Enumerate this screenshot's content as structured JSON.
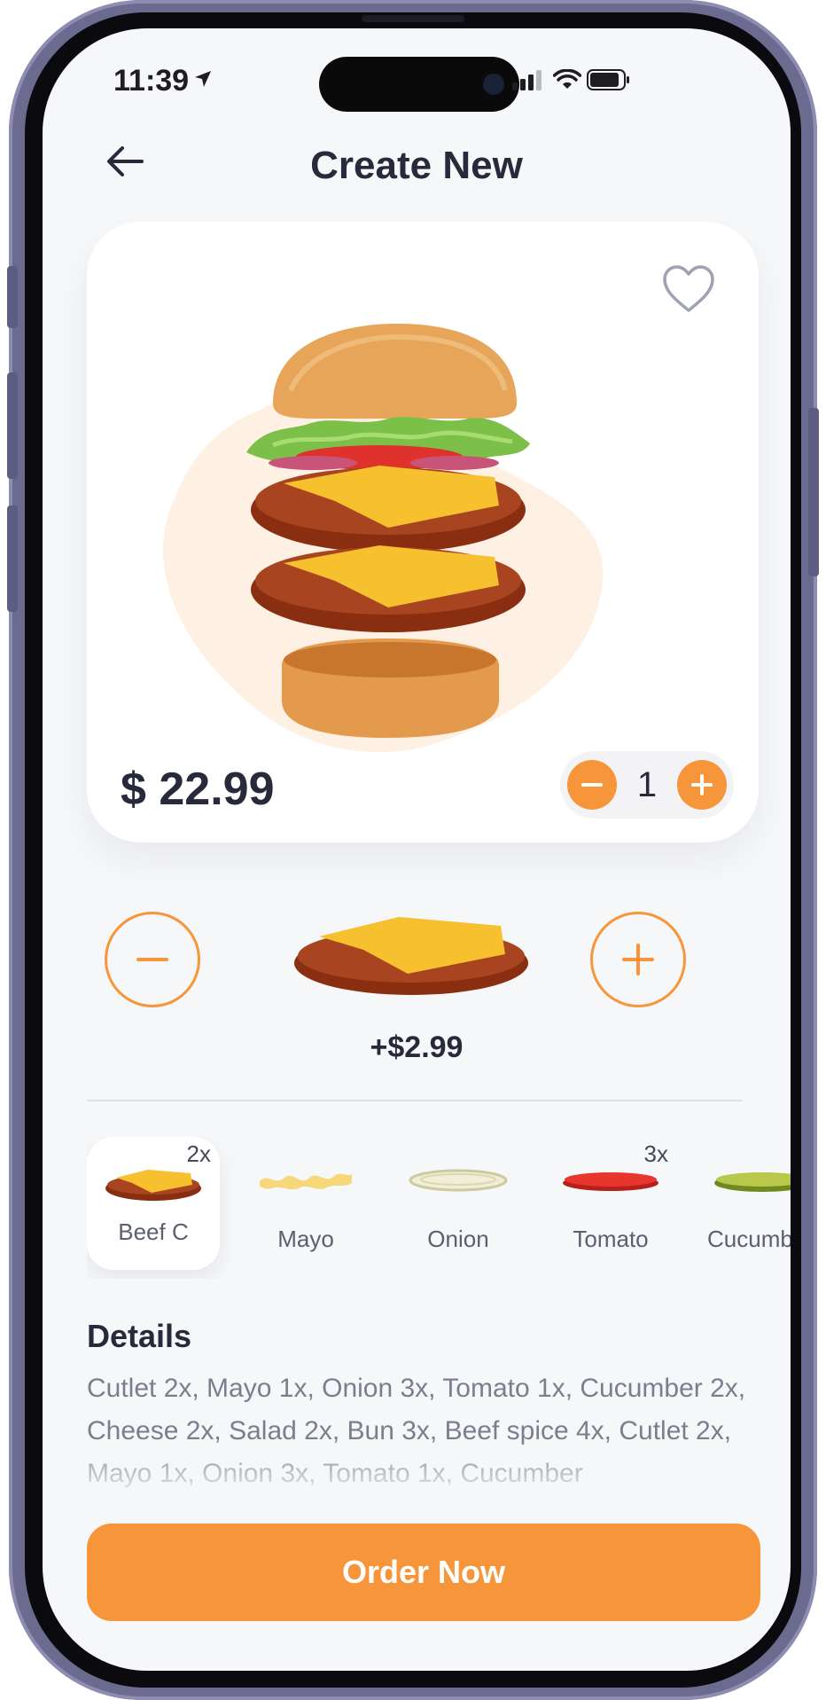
{
  "status_bar": {
    "time": "11:39"
  },
  "header": {
    "title": "Create New"
  },
  "product": {
    "price": "$ 22.99",
    "quantity": "1",
    "favorited": false
  },
  "ingredient_selector": {
    "add_price": "+$2.99"
  },
  "ingredients": [
    {
      "label": "Beef C",
      "badge": "2x",
      "selected": true
    },
    {
      "label": "Mayo",
      "badge": "",
      "selected": false
    },
    {
      "label": "Onion",
      "badge": "",
      "selected": false
    },
    {
      "label": "Tomato",
      "badge": "3x",
      "selected": false
    },
    {
      "label": "Cucumb",
      "badge": "",
      "selected": false
    }
  ],
  "details": {
    "title": "Details",
    "text": "Cutlet 2x, Mayo 1x, Onion 3x, Tomato 1x, Cucumber 2x, Cheese 2x, Salad 2x,  Bun 3x, Beef spice 4x, Cutlet 2x, Mayo 1x, Onion 3x, Tomato 1x, Cucumber"
  },
  "order_button": {
    "label": "Order Now"
  },
  "colors": {
    "accent": "#f7953a",
    "text_dark": "#262a3a",
    "text_muted": "#7a7f8e",
    "background": "#f6f7f9"
  }
}
